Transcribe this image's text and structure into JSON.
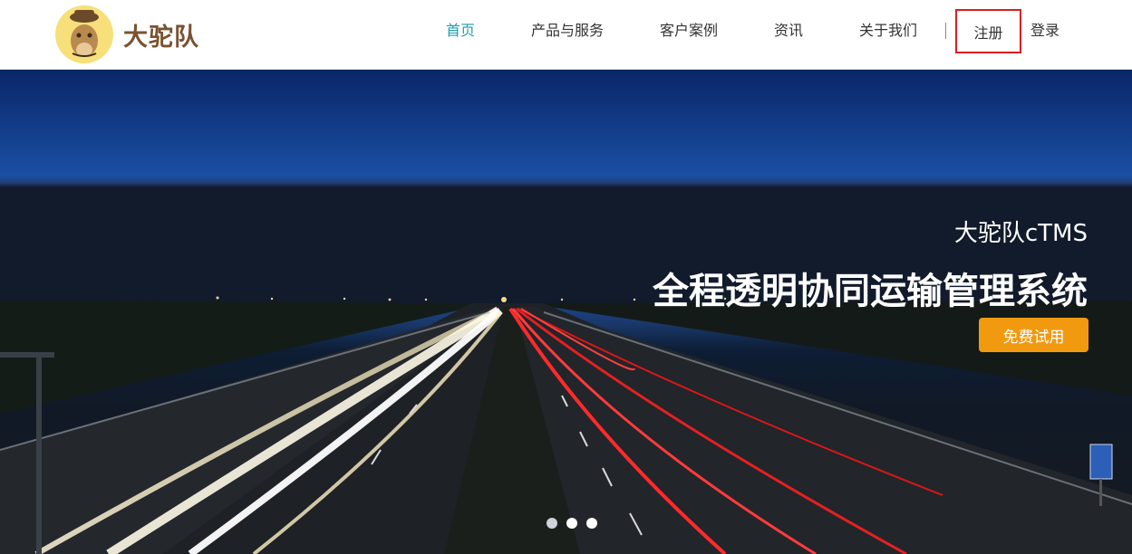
{
  "brand": {
    "name": "大驼队"
  },
  "nav": {
    "items": [
      {
        "label": "首页",
        "active": true
      },
      {
        "label": "产品与服务",
        "active": false
      },
      {
        "label": "客户案例",
        "active": false
      },
      {
        "label": "资讯",
        "active": false
      },
      {
        "label": "关于我们",
        "active": false
      }
    ],
    "register_label": "注册",
    "login_label": "登录"
  },
  "hero": {
    "subtitle": "大驼队cTMS",
    "title": "全程透明协同运输管理系统",
    "cta_label": "免费试用",
    "slides": 3,
    "active_slide": 2
  },
  "colors": {
    "accent": "#1a9fb0",
    "cta": "#f19a10",
    "highlight_box": "#d91f1f",
    "brand_text": "#7a5230"
  }
}
